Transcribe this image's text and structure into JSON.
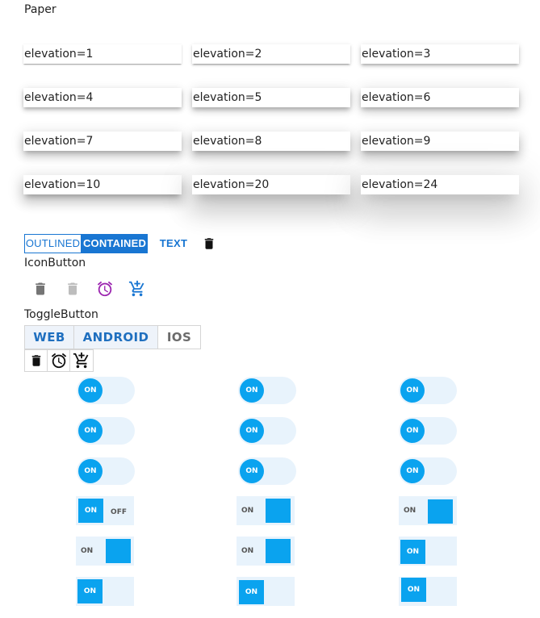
{
  "paper": {
    "heading": "Paper",
    "items": [
      "elevation=1",
      "elevation=2",
      "elevation=3",
      "elevation=4",
      "elevation=5",
      "elevation=6",
      "elevation=7",
      "elevation=8",
      "elevation=9",
      "elevation=10",
      "elevation=20",
      "elevation=24"
    ]
  },
  "buttons": {
    "outlined": "OUTLINED",
    "contained": "CONTAINED",
    "text": "TEXT",
    "icon": "delete-icon"
  },
  "iconbutton": {
    "heading": "IconButton",
    "icons": [
      "delete-icon",
      "delete-icon-disabled",
      "alarm-icon",
      "add-shopping-cart-icon"
    ]
  },
  "togglebutton": {
    "heading": "ToggleButton",
    "options": [
      "WEB",
      "ANDROID",
      "IOS"
    ],
    "selected": [
      "WEB",
      "ANDROID"
    ],
    "icon_options": [
      "delete-icon",
      "alarm-icon",
      "add-shopping-cart-icon"
    ]
  },
  "switches": {
    "on_label": "ON",
    "off_label": "OFF"
  },
  "colors": {
    "primary": "#1976d2",
    "secondary": "#9c27b0",
    "switch_accent": "#0aa3ef",
    "switch_track": "#e8f3fc"
  }
}
